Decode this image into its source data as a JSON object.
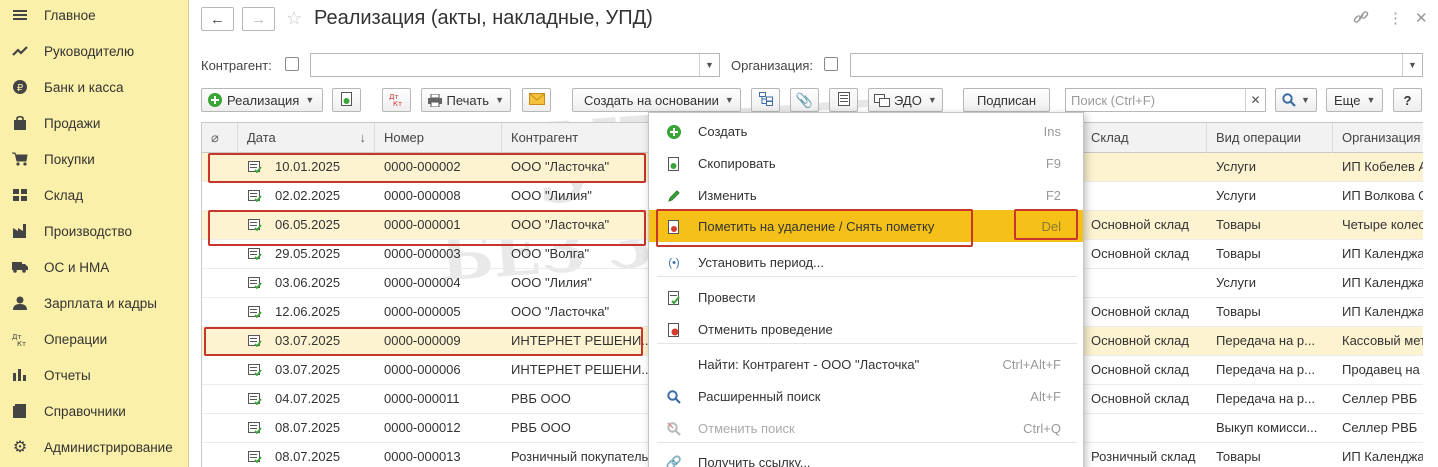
{
  "sidebar": {
    "items": [
      {
        "label": "Главное",
        "icon": "menu-icon"
      },
      {
        "label": "Руководителю",
        "icon": "trend-icon"
      },
      {
        "label": "Банк и касса",
        "icon": "ruble-icon"
      },
      {
        "label": "Продажи",
        "icon": "bag-icon"
      },
      {
        "label": "Покупки",
        "icon": "cart-icon"
      },
      {
        "label": "Склад",
        "icon": "warehouse-icon"
      },
      {
        "label": "Производство",
        "icon": "factory-icon"
      },
      {
        "label": "ОС и НМА",
        "icon": "truck-icon"
      },
      {
        "label": "Зарплата и кадры",
        "icon": "person-icon"
      },
      {
        "label": "Операции",
        "icon": "dt-kt-icon"
      },
      {
        "label": "Отчеты",
        "icon": "chart-icon"
      },
      {
        "label": "Справочники",
        "icon": "book-icon"
      },
      {
        "label": "Администрирование",
        "icon": "gear-icon"
      }
    ]
  },
  "header": {
    "title": "Реализация (акты, накладные, УПД)"
  },
  "filters": {
    "counterparty_label": "Контрагент:",
    "organization_label": "Организация:",
    "counterparty_value": "",
    "organization_value": ""
  },
  "toolbar": {
    "realization": "Реализация",
    "dt_kt": "Дт Кт",
    "print": "Печать",
    "create_based_on": "Создать на основании",
    "edo": "ЭДО",
    "signed": "Подписан",
    "search_placeholder": "Поиск (Ctrl+F)",
    "more": "Еще",
    "help": "?"
  },
  "table": {
    "columns": [
      "Дата",
      "Номер",
      "Контрагент",
      "Склад",
      "Вид операции",
      "Организация"
    ],
    "rows": [
      {
        "date": "10.01.2025",
        "number": "0000-000002",
        "counterparty": "ООО \"Ласточка\"",
        "warehouse": "",
        "operation": "Услуги",
        "organization": "ИП Кобелев А",
        "highlight": true
      },
      {
        "date": "02.02.2025",
        "number": "0000-000008",
        "counterparty": "ООО \"Лилия\"",
        "warehouse": "",
        "operation": "Услуги",
        "organization": "ИП Волкова С",
        "highlight": false
      },
      {
        "date": "06.05.2025",
        "number": "0000-000001",
        "counterparty": "ООО \"Ласточка\"",
        "warehouse": "Основной склад",
        "operation": "Товары",
        "organization": "Четыре колес",
        "highlight": true
      },
      {
        "date": "29.05.2025",
        "number": "0000-000003",
        "counterparty": "ООО \"Волга\"",
        "warehouse": "Основной склад",
        "operation": "Товары",
        "organization": "ИП Календжа",
        "highlight": false
      },
      {
        "date": "03.06.2025",
        "number": "0000-000004",
        "counterparty": "ООО \"Лилия\"",
        "warehouse": "",
        "operation": "Услуги",
        "organization": "ИП Календжа",
        "highlight": false
      },
      {
        "date": "12.06.2025",
        "number": "0000-000005",
        "counterparty": "ООО \"Ласточка\"",
        "warehouse": "Основной склад",
        "operation": "Товары",
        "organization": "ИП Календжа",
        "highlight": false
      },
      {
        "date": "03.07.2025",
        "number": "0000-000009",
        "counterparty": "ИНТЕРНЕТ РЕШЕНИ...",
        "warehouse": "Основной склад",
        "operation": "Передача на р...",
        "organization": "Кассовый мет",
        "highlight": true
      },
      {
        "date": "03.07.2025",
        "number": "0000-000006",
        "counterparty": "ИНТЕРНЕТ РЕШЕНИ...",
        "warehouse": "Основной склад",
        "operation": "Передача на р...",
        "organization": "Продавец на",
        "highlight": false
      },
      {
        "date": "04.07.2025",
        "number": "0000-000011",
        "counterparty": "РВБ ООО",
        "warehouse": "Основной склад",
        "operation": "Передача на р...",
        "organization": "Селлер РВБ",
        "highlight": false
      },
      {
        "date": "08.07.2025",
        "number": "0000-000012",
        "counterparty": "РВБ ООО",
        "warehouse": "",
        "operation": "Выкуп комисси...",
        "organization": "Селлер РВБ",
        "highlight": false
      },
      {
        "date": "08.07.2025",
        "number": "0000-000013",
        "counterparty": "Розничный покупатель",
        "warehouse": "Розничный склад",
        "operation": "Товары",
        "organization": "ИП Календжа",
        "highlight": false
      }
    ]
  },
  "context_menu": {
    "items": [
      {
        "label": "Создать",
        "shortcut": "Ins",
        "icon": "plus-icon"
      },
      {
        "label": "Скопировать",
        "shortcut": "F9",
        "icon": "copy-icon"
      },
      {
        "label": "Изменить",
        "shortcut": "F2",
        "icon": "pencil-icon"
      },
      {
        "label": "Пометить на удаление / Снять пометку",
        "shortcut": "Del",
        "icon": "delete-mark-icon"
      },
      {
        "label": "Установить период...",
        "shortcut": "",
        "icon": "period-icon"
      },
      {
        "label": "Провести",
        "shortcut": "",
        "icon": "post-icon"
      },
      {
        "label": "Отменить проведение",
        "shortcut": "",
        "icon": "unpost-icon"
      },
      {
        "label": "Найти: Контрагент - ООО \"Ласточка\"",
        "shortcut": "Ctrl+Alt+F",
        "icon": ""
      },
      {
        "label": "Расширенный поиск",
        "shortcut": "Alt+F",
        "icon": "search-icon"
      },
      {
        "label": "Отменить поиск",
        "shortcut": "Ctrl+Q",
        "icon": "cancel-search-icon"
      },
      {
        "label": "Получить ссылку...",
        "shortcut": "",
        "icon": "link-icon"
      }
    ]
  },
  "watermark": {
    "line1": "УЧЕТ",
    "line2": "БЕЗ ЗАБОТ"
  },
  "colors": {
    "sidebar_bg": "#fbf0a9",
    "highlight_row": "#fdf3d1",
    "menu_active": "#f5c118",
    "red_frame": "#c8352b",
    "green_icon": "#3aa537"
  }
}
